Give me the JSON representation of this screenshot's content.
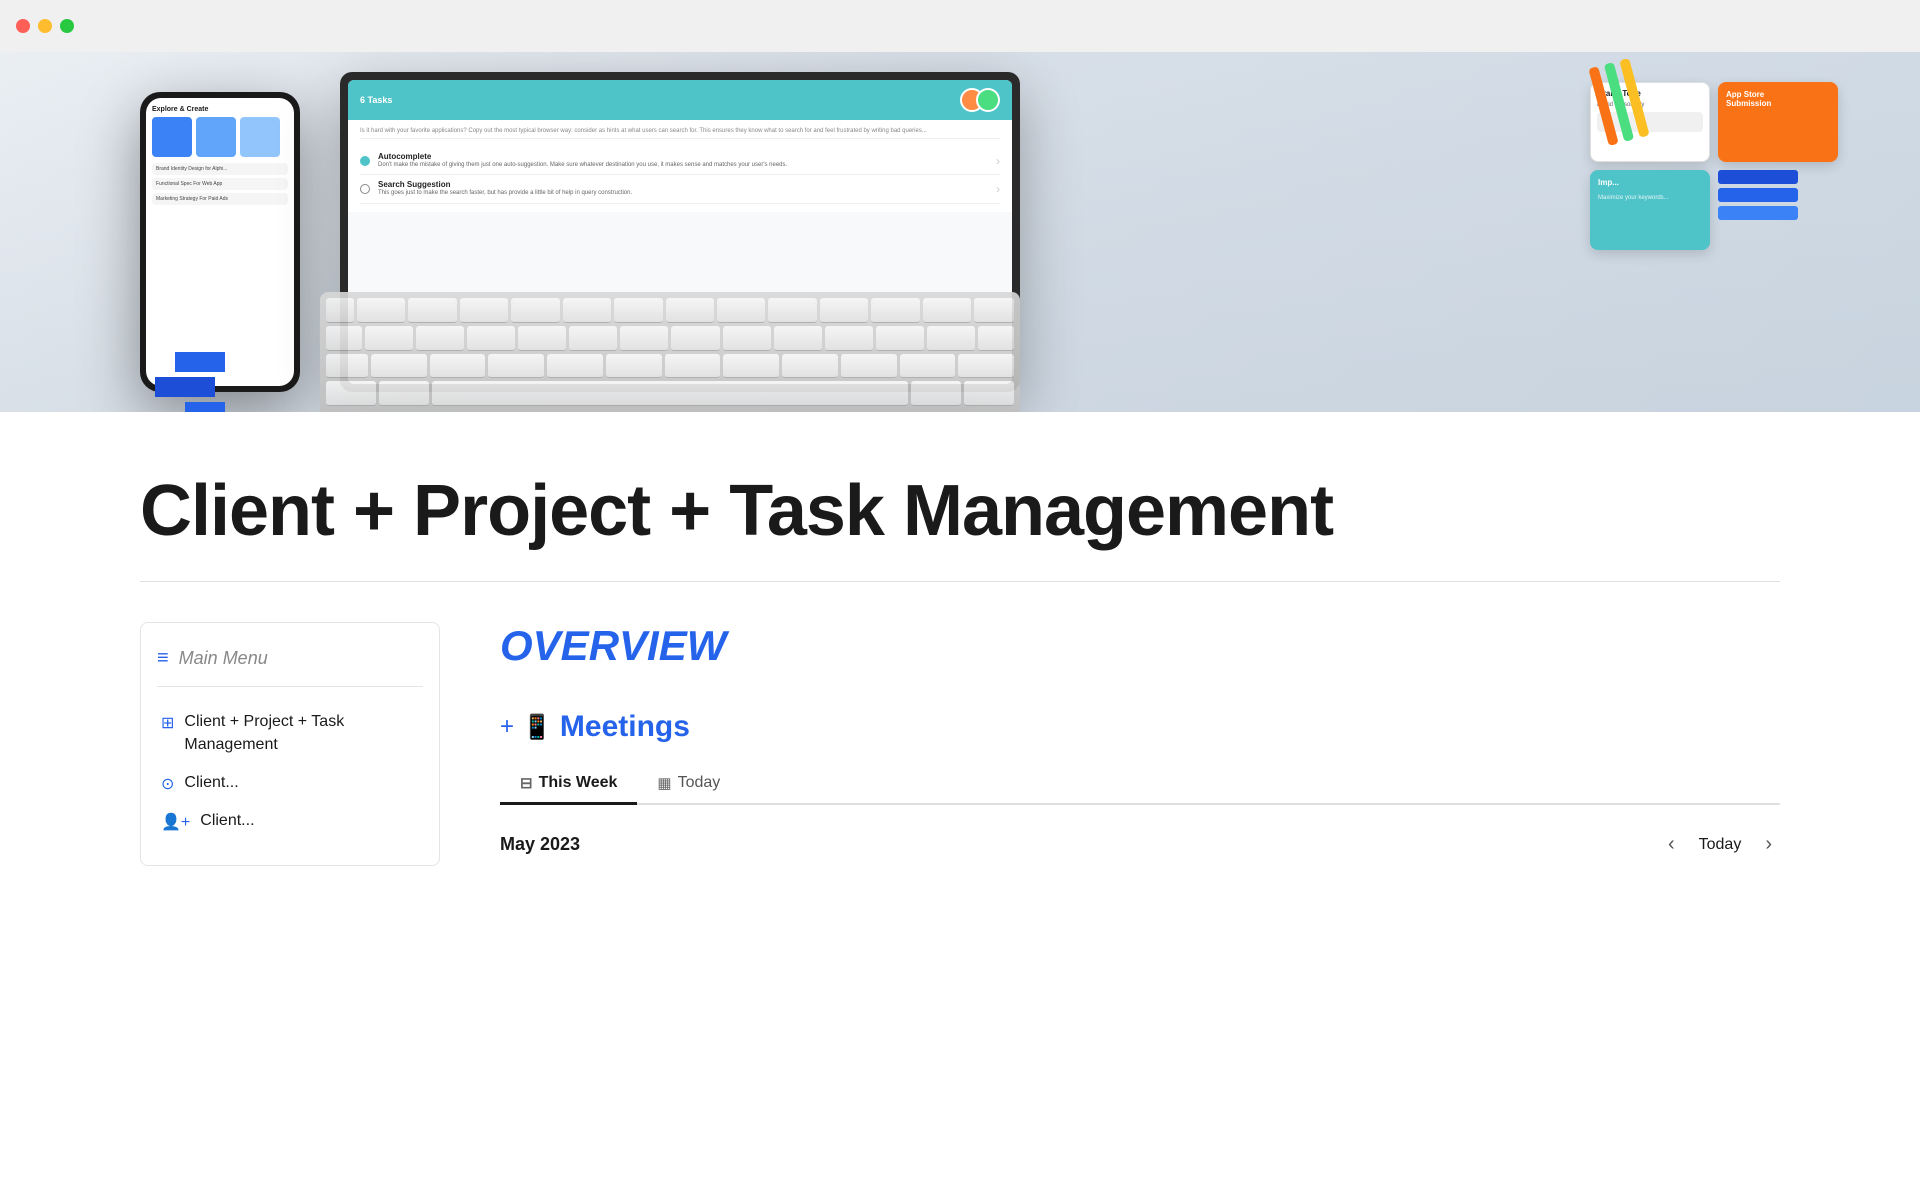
{
  "titlebar": {
    "traffic_lights": [
      "red",
      "yellow",
      "green"
    ]
  },
  "hero": {
    "phone": {
      "title": "Explore & Create",
      "items": [
        "Brand Identity Design for Alphi...",
        "Functional Spec For Web App",
        "Marketing Strategy For Paid Ads"
      ]
    },
    "tablet": {
      "header": "6 Tasks",
      "rows": [
        {
          "checked": false,
          "label": "Autocomplete",
          "desc": "Don't make the mistake of giving them just one auto-suggestion. Make sure whatever destination you use, it makes sense and matches your user's needs."
        },
        {
          "checked": false,
          "label": "Search Suggestion",
          "desc": "This goes just to make the search faster, but has provide a little bit of help in query construction."
        }
      ]
    }
  },
  "page": {
    "title": "Client + Project + Task Management"
  },
  "sidebar": {
    "header_label": "Main Menu",
    "items": [
      {
        "icon": "grid-icon",
        "label": "Client + Project + Task Management"
      },
      {
        "icon": "user-circle-icon",
        "label": "Client..."
      },
      {
        "icon": "user-plus-icon",
        "label": "Client..."
      }
    ]
  },
  "main_panel": {
    "overview_title": "OVERVIEW",
    "meetings_section": {
      "add_icon": "+",
      "emoji": "📱",
      "title": "Meetings",
      "tabs": [
        {
          "label": "This Week",
          "icon": "calendar-week-icon",
          "active": true
        },
        {
          "label": "Today",
          "icon": "calendar-today-icon",
          "active": false
        }
      ],
      "calendar": {
        "month": "May 2023",
        "today_label": "Today"
      }
    }
  }
}
